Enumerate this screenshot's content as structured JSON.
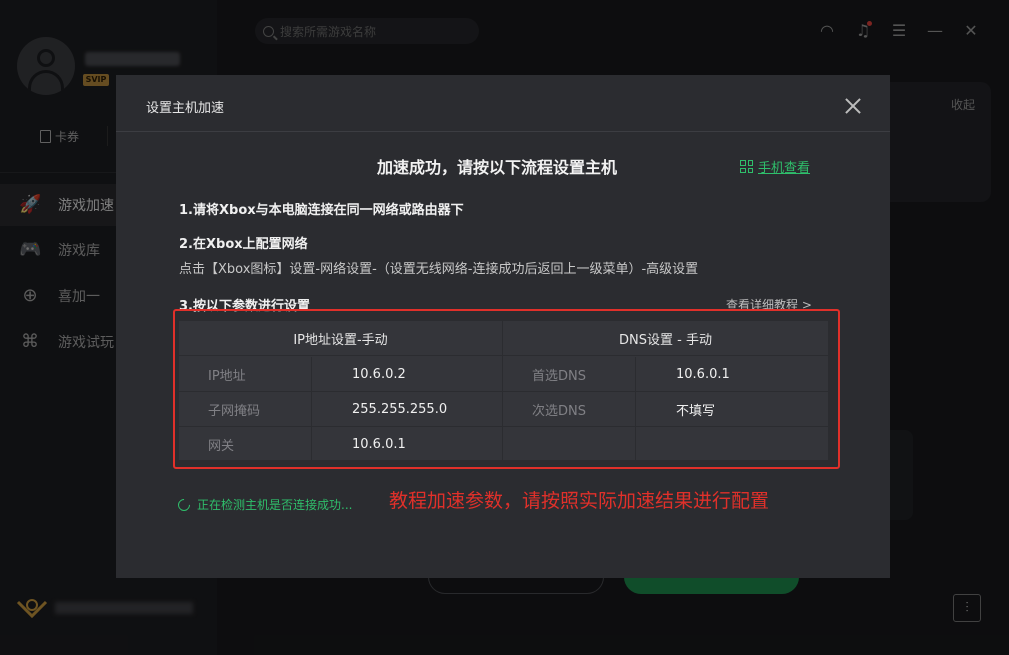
{
  "app": {
    "svip_badge": "SVIP",
    "coupon_label": "卡券",
    "nav": [
      {
        "label": "游戏加速",
        "icon": "rocket-icon"
      },
      {
        "label": "游戏库",
        "icon": "gamepad-icon"
      },
      {
        "label": "喜加一",
        "icon": "gift-icon"
      },
      {
        "label": "游戏试玩",
        "icon": "joystick-icon"
      }
    ],
    "search_placeholder": "搜索所需游戏名称",
    "collapse_label": "收起",
    "top_icons": [
      "headset-icon",
      "bell-icon",
      "menu-icon",
      "minimize-icon",
      "close-icon"
    ]
  },
  "modal": {
    "title": "设置主机加速",
    "headline": "加速成功，请按以下流程设置主机",
    "phone_link": "手机查看",
    "step1": "1.请将Xbox与本电脑连接在同一网络或路由器下",
    "step2": "2.在Xbox上配置网络",
    "step2_desc": "点击【Xbox图标】设置-网络设置-（设置无线网络-连接成功后返回上一级菜单）-高级设置",
    "step3": "3.按以下参数进行设置",
    "tutorial_link": "查看详细教程 >",
    "table": {
      "ip_header": "IP地址设置-手动",
      "dns_header": "DNS设置 - 手动",
      "ip_rows": [
        {
          "label": "IP地址",
          "value": "10.6.0.2"
        },
        {
          "label": "子网掩码",
          "value": "255.255.255.0"
        },
        {
          "label": "网关",
          "value": "10.6.0.1"
        }
      ],
      "dns_rows": [
        {
          "label": "首选DNS",
          "value": "10.6.0.1"
        },
        {
          "label": "次选DNS",
          "value": "不填写"
        },
        {
          "label": "",
          "value": ""
        }
      ]
    },
    "detecting": "正在检测主机是否连接成功...",
    "annotation": "教程加速参数，请按照实际加速结果进行配置"
  },
  "colors": {
    "accent_green": "#2fbf6b",
    "annotation_red": "#e0302a",
    "modal_bg": "#2b2c30"
  }
}
